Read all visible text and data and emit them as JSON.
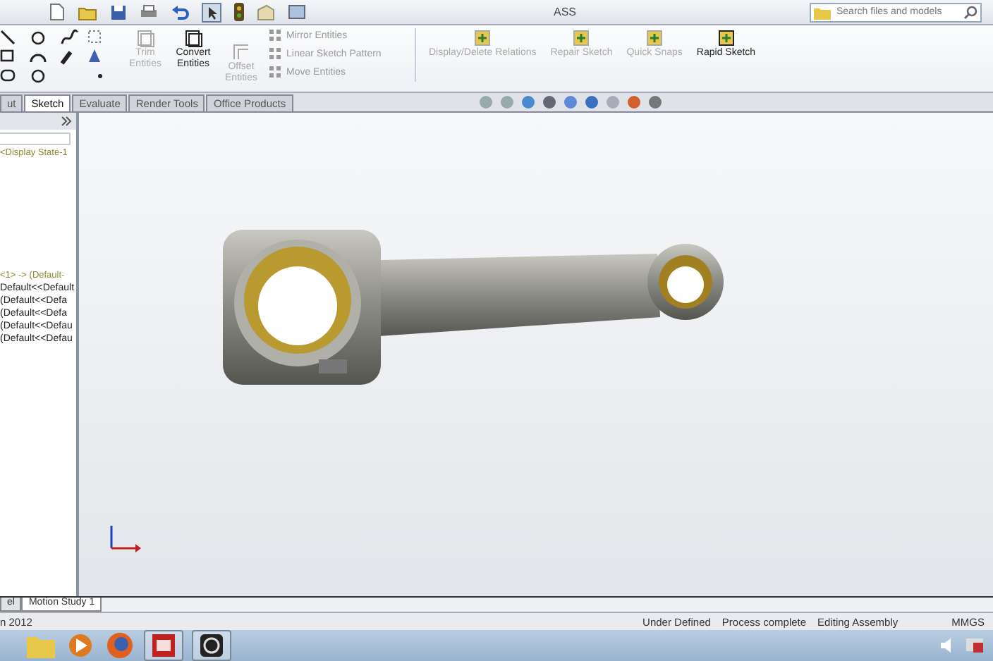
{
  "window": {
    "title": "ASS"
  },
  "search": {
    "placeholder": "Search files and models"
  },
  "ribbon": {
    "large_buttons": [
      {
        "label": "Trim Entities",
        "disabled": true
      },
      {
        "label": "Convert Entities",
        "disabled": false
      }
    ],
    "offset": {
      "label": "Offset Entities",
      "disabled": true
    },
    "small_buttons": [
      {
        "label": "Mirror Entities",
        "disabled": true
      },
      {
        "label": "Linear Sketch Pattern",
        "disabled": true
      },
      {
        "label": "Move Entities",
        "disabled": true
      }
    ],
    "right_buttons": [
      {
        "label": "Display/Delete Relations",
        "disabled": true
      },
      {
        "label": "Repair Sketch",
        "disabled": true
      },
      {
        "label": "Quick Snaps",
        "disabled": true
      },
      {
        "label": "Rapid Sketch",
        "disabled": false
      }
    ]
  },
  "tabs": [
    {
      "label": "ut",
      "selected": false
    },
    {
      "label": "Sketch",
      "selected": true
    },
    {
      "label": "Evaluate",
      "selected": false
    },
    {
      "label": "Render Tools",
      "selected": false
    },
    {
      "label": "Office Products",
      "selected": false
    }
  ],
  "tree": {
    "header": "<Display State-1",
    "items": [
      "<1> -> (Default-",
      "Default<<Default",
      "(Default<<Defa",
      "(Default<<Defa",
      "(Default<<Defau",
      "(Default<<Defau"
    ]
  },
  "bottom_tabs": [
    {
      "label": "el",
      "selected": false
    },
    {
      "label": "Motion Study 1",
      "selected": true
    }
  ],
  "status_bar": {
    "left": "n 2012",
    "items": [
      "Under Defined",
      "Process complete",
      "Editing Assembly"
    ],
    "units": "MMGS"
  }
}
